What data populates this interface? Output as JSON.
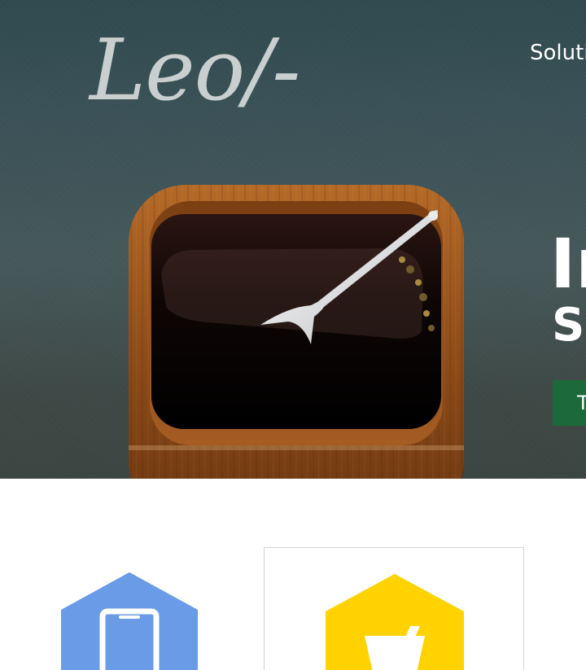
{
  "brand": {
    "logo_text": "Leo/-"
  },
  "nav": {
    "item_label": "Solutio"
  },
  "hero": {
    "headline": "In",
    "subheadline": "So",
    "cta_label": "Tr"
  },
  "colors": {
    "cta_green": "#1c6a3b",
    "badge_blue": "#6a9be6",
    "badge_yellow": "#ffd200"
  },
  "features": [
    {
      "icon": "phone-icon",
      "color": "#6a9be6"
    },
    {
      "icon": "cup-icon",
      "color": "#ffd200"
    }
  ]
}
